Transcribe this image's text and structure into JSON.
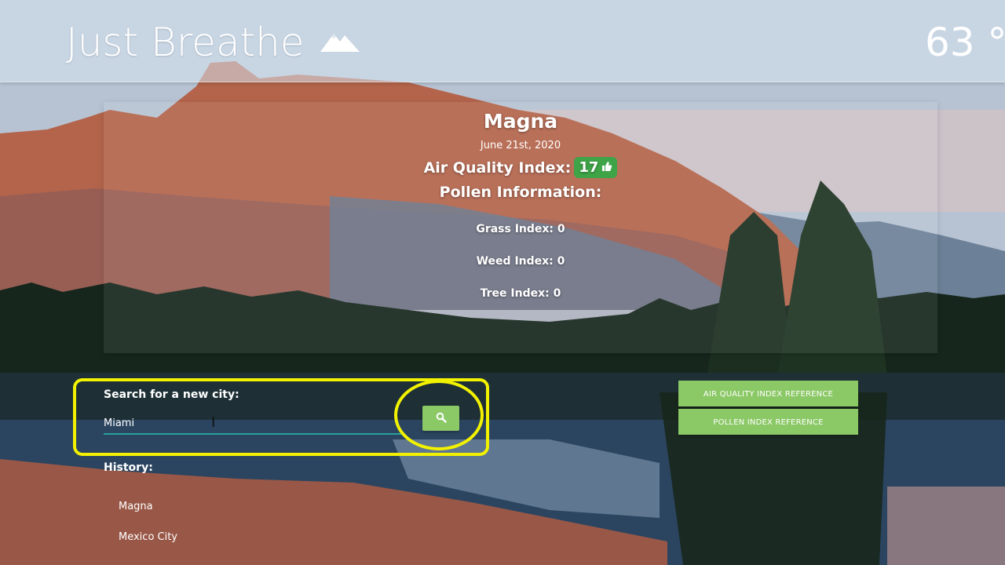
{
  "navbar": {
    "brand": "Just Breathe",
    "brand_icon": "mountains-icon",
    "temperature": "63 °"
  },
  "info": {
    "city": "Magna",
    "date": "June 21st, 2020",
    "aqi_label": "Air Quality Index:",
    "aqi_value": "17",
    "aqi_icon": "thumbs-up-icon",
    "aqi_color": "#3ea447",
    "pollen_title": "Pollen Information:",
    "grass": "Grass Index: 0",
    "weed": "Weed Index: 0",
    "tree": "Tree Index: 0"
  },
  "search": {
    "label": "Search for a new city:",
    "value": "Miami",
    "button_icon": "search-icon",
    "button_color": "#8bc866"
  },
  "references": {
    "aqi_button": "AIR QUALITY INDEX REFERENCE",
    "pollen_button": "POLLEN INDEX REFERENCE"
  },
  "history": {
    "title": "History:",
    "items": [
      "Magna",
      "Mexico City"
    ]
  },
  "annotation": {
    "color": "#f2f200"
  }
}
